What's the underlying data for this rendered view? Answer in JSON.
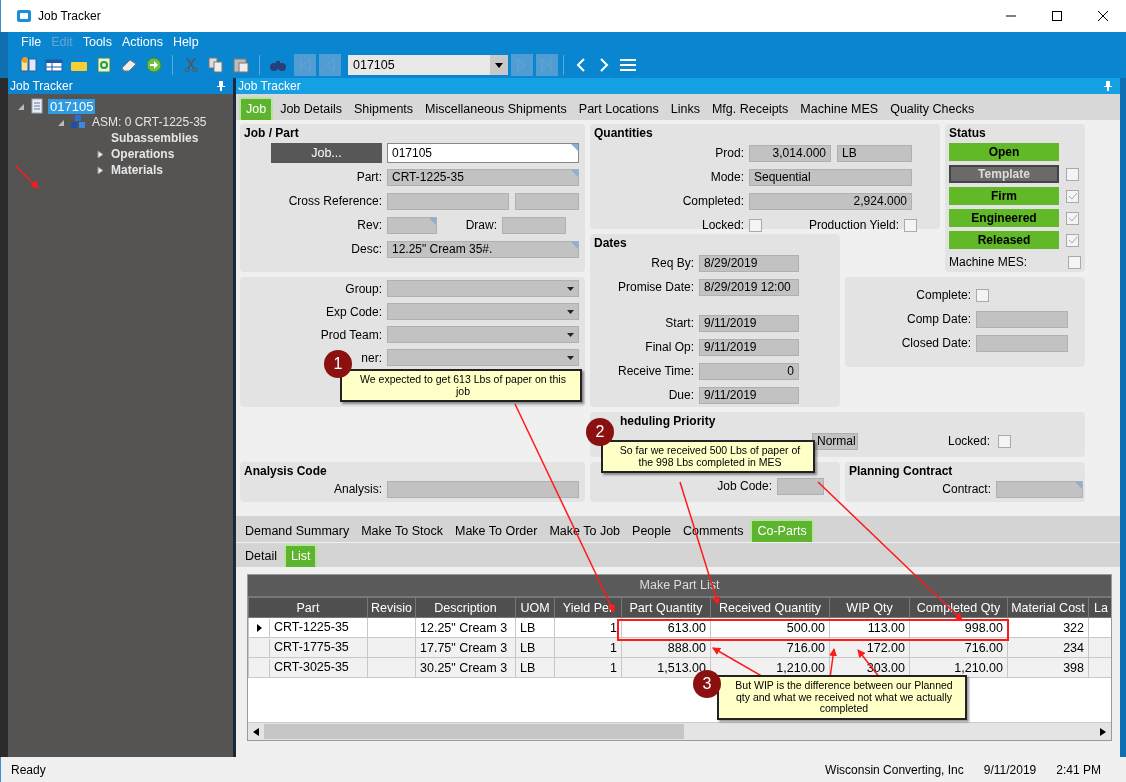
{
  "window": {
    "title": "Job Tracker"
  },
  "menu": [
    {
      "label": "File",
      "disabled": false
    },
    {
      "label": "Edit",
      "disabled": true
    },
    {
      "label": "Tools",
      "disabled": false
    },
    {
      "label": "Actions",
      "disabled": false
    },
    {
      "label": "Help",
      "disabled": false
    }
  ],
  "toolbar": {
    "record": "017105"
  },
  "tree_panel": {
    "title": "Job Tracker",
    "items": [
      {
        "label": "017105",
        "kind": "branch",
        "expanded": true,
        "selected": true,
        "children": [
          {
            "label": "ASM: 0 CRT-1225-35",
            "kind": "branch",
            "expanded": true,
            "selected": false,
            "children": [
              {
                "label": "Subassemblies",
                "kind": "leaf",
                "selected": false
              },
              {
                "label": "Operations",
                "kind": "branch",
                "expanded": false,
                "selected": false
              },
              {
                "label": "Materials",
                "kind": "branch",
                "expanded": false,
                "selected": false
              }
            ]
          }
        ]
      }
    ]
  },
  "main_panel": {
    "title": "Job Tracker"
  },
  "tabs": [
    {
      "label": "Job",
      "selected": true
    },
    {
      "label": "Job Details",
      "selected": false
    },
    {
      "label": "Shipments",
      "selected": false
    },
    {
      "label": "Miscellaneous Shipments",
      "selected": false
    },
    {
      "label": "Part Locations",
      "selected": false
    },
    {
      "label": "Links",
      "selected": false
    },
    {
      "label": "Mfg. Receipts",
      "selected": false
    },
    {
      "label": "Machine MES",
      "selected": false
    },
    {
      "label": "Quality Checks",
      "selected": false
    }
  ],
  "job_part": {
    "title": "Job / Part",
    "job_button": "Job...",
    "job": "017105",
    "part_label": "Part:",
    "part": "CRT-1225-35",
    "cross_reference_label": "Cross Reference:",
    "rev_label": "Rev:",
    "draw_label": "Draw:",
    "desc_label": "Desc:",
    "desc": "12.25\" Cream 35#."
  },
  "codes": [
    {
      "label": "Group:"
    },
    {
      "label": "Exp Code:"
    },
    {
      "label": "Prod Team:"
    },
    {
      "label": "ner:"
    }
  ],
  "quantities": {
    "title": "Quantities",
    "prod_label": "Prod:",
    "prod": "3,014.000",
    "uom": "LB",
    "mode_label": "Mode:",
    "mode": "Sequential",
    "completed_label": "Completed:",
    "completed": "2,924.000",
    "locked_label": "Locked:",
    "locked": false,
    "yield_label": "Production Yield:",
    "production_yield": false
  },
  "status": {
    "title": "Status",
    "items": [
      {
        "label": "Open",
        "kind": "plain",
        "on": true
      },
      {
        "label": "Template",
        "kind": "check",
        "on": false,
        "checked": false
      },
      {
        "label": "Firm",
        "kind": "check",
        "on": true,
        "checked": true
      },
      {
        "label": "Engineered",
        "kind": "check",
        "on": true,
        "checked": true
      },
      {
        "label": "Released",
        "kind": "check",
        "on": true,
        "checked": true
      }
    ],
    "machine_mes_label": "Machine MES:",
    "machine_mes": false
  },
  "dates": {
    "title": "Dates",
    "rows": [
      {
        "label": "Req By:",
        "value": "8/29/2019"
      },
      {
        "label": "Promise Date:",
        "value": "8/29/2019 12:00"
      },
      {
        "label": "Start:",
        "value": "9/11/2019"
      },
      {
        "label": "Final Op:",
        "value": "9/11/2019"
      },
      {
        "label": "Receive Time:",
        "value": "0"
      },
      {
        "label": "Due:",
        "value": "9/11/2019"
      }
    ]
  },
  "completion": {
    "complete_label": "Complete:",
    "complete": false,
    "comp_date_label": "Comp Date:",
    "closed_date_label": "Closed Date:"
  },
  "scheduling": {
    "title": "heduling Priority",
    "priority": "Normal",
    "locked_label": "Locked:",
    "locked": false
  },
  "analysis": {
    "title": "Analysis Code",
    "label": "Analysis:"
  },
  "job_code": {
    "label": "Job Code:"
  },
  "planning": {
    "title": "Planning Contract",
    "label": "Contract:"
  },
  "lower_tabs": [
    {
      "label": "Demand Summary",
      "selected": false
    },
    {
      "label": "Make To Stock",
      "selected": false
    },
    {
      "label": "Make To Order",
      "selected": false
    },
    {
      "label": "Make To Job",
      "selected": false
    },
    {
      "label": "People",
      "selected": false
    },
    {
      "label": "Comments",
      "selected": false
    },
    {
      "label": "Co-Parts",
      "selected": true
    }
  ],
  "sub_tabs": [
    {
      "label": "Detail",
      "selected": false
    },
    {
      "label": "List",
      "selected": true
    }
  ],
  "table": {
    "title": "Make Part List",
    "columns": [
      "Part",
      "Revisio",
      "Description",
      "UOM",
      "Yield Per",
      "Part Quantity",
      "Received Quantity",
      "WIP Qty",
      "Completed Qty",
      "Material Cost",
      "La"
    ],
    "rows": [
      {
        "current": true,
        "cells": [
          "CRT-1225-35",
          "",
          "12.25\" Cream 3",
          "LB",
          "1",
          "613.00",
          "500.00",
          "113.00",
          "998.00",
          "322"
        ]
      },
      {
        "current": false,
        "cells": [
          "CRT-1775-35",
          "",
          "17.75\" Cream 3",
          "LB",
          "1",
          "888.00",
          "716.00",
          "172.00",
          "716.00",
          "234"
        ]
      },
      {
        "current": false,
        "cells": [
          "CRT-3025-35",
          "",
          "30.25\" Cream 3",
          "LB",
          "1",
          "1,513.00",
          "1,210.00",
          "303.00",
          "1,210.00",
          "398"
        ]
      }
    ]
  },
  "callouts": [
    {
      "number": "1",
      "text": "We expected to get 613 Lbs of paper on this job"
    },
    {
      "number": "2",
      "text": "So far we received 500 Lbs of paper of the 998 Lbs completed in MES"
    },
    {
      "number": "3",
      "text": "But WIP is the difference between our Planned qty and what we received not what we actually completed"
    }
  ],
  "status_bar": {
    "message": "Ready",
    "company": "Wisconsin Converting, Inc",
    "date": "9/11/2019",
    "time": "2:41 PM"
  }
}
